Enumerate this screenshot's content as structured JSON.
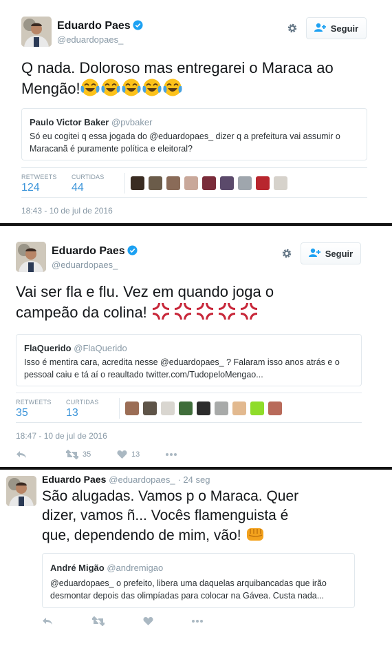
{
  "tweets": [
    {
      "author": "Eduardo Paes",
      "handle": "@eduardopaes_",
      "follow_label": "Seguir",
      "text_line1": "Q nada.  Doloroso mas entregarei o Maraca ao",
      "text_line2": "Mengão!",
      "trailing_emoji": "face-with-tears-of-joy x5",
      "quote": {
        "author": "Paulo Victor Baker",
        "handle": "@pvbaker",
        "line1": "Só eu cogitei q essa jogada do @eduardopaes_ dizer q a prefeitura vai assumir o",
        "line2": "Maracanã é puramente política e eleitoral?"
      },
      "retweets_label": "RETWEETS",
      "retweets": "124",
      "likes_label": "CURTIDAS",
      "likes": "44",
      "timestamp": "18:43 - 10 de jul de 2016"
    },
    {
      "author": "Eduardo Paes",
      "handle": "@eduardopaes_",
      "follow_label": "Seguir",
      "text_line1": "Vai ser fla e flu.  Vez em quando joga o",
      "text_line2": "campeão da colina!",
      "trailing_emoji": "anger-symbol x5",
      "quote": {
        "author": "FlaQuerido",
        "handle": "@FlaQuerido",
        "line1": "Isso é mentira cara, acredita nesse  @eduardopaes_ ? Falaram isso anos atrás e o",
        "line2": "pessoal caiu e tá aí o reaultado twitter.com/TudopeloMengao..."
      },
      "retweets_label": "RETWEETS",
      "retweets": "35",
      "likes_label": "CURTIDAS",
      "likes": "13",
      "timestamp": "18:47 - 10 de jul de 2016",
      "action_retweets": "35",
      "action_likes": "13"
    },
    {
      "author": "Eduardo Paes",
      "handle": "@eduardopaes_",
      "time_ago": "· 24 seg",
      "text_line1": "São alugadas.  Vamos p o Maraca.  Quer",
      "text_line2": "dizer, vamos ñ...  Vocês flamenguista é",
      "text_line3": "que, dependendo de mim, vão!",
      "trailing_emoji": "fisted-hand",
      "quote": {
        "author": "André Migão",
        "handle": "@andremigao",
        "line1": "@eduardopaes_ o prefeito, libera uma daquelas arquibancadas que irão",
        "line2": "desmontar depois das olimpíadas para colocar na Gávea. Custa nada..."
      }
    }
  ],
  "colors": {
    "link_blue": "#3b94d9",
    "muted": "#8899a6",
    "border": "#e1e8ed",
    "verified": "#1da1f2",
    "anger_red": "#c8273a",
    "fist_orange": "#f3a21d"
  }
}
